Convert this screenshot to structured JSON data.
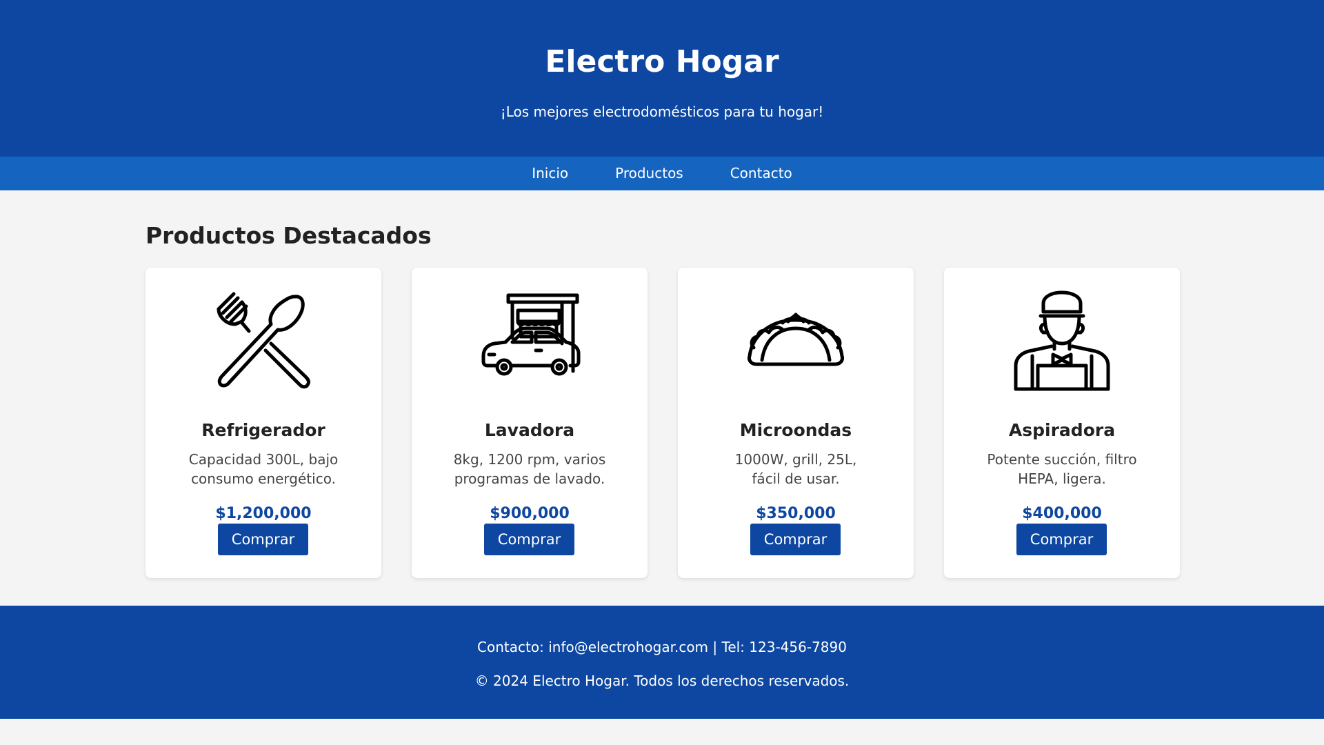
{
  "header": {
    "title": "Electro Hogar",
    "tagline": "¡Los mejores electrodomésticos para tu hogar!"
  },
  "nav": {
    "items": [
      {
        "label": "Inicio"
      },
      {
        "label": "Productos"
      },
      {
        "label": "Contacto"
      }
    ]
  },
  "main": {
    "section_title": "Productos Destacados",
    "products": [
      {
        "name": "Refrigerador",
        "description": "Capacidad 300L, bajo consumo energético.",
        "price": "$1,200,000",
        "button_label": "Comprar",
        "icon": "fork-spoon-icon"
      },
      {
        "name": "Lavadora",
        "description": "8kg, 1200 rpm, varios programas de lavado.",
        "price": "$900,000",
        "button_label": "Comprar",
        "icon": "drive-thru-car-icon"
      },
      {
        "name": "Microondas",
        "description": "1000W, grill, 25L, fácil de usar.",
        "price": "$350,000",
        "button_label": "Comprar",
        "icon": "taco-icon"
      },
      {
        "name": "Aspiradora",
        "description": "Potente succión, filtro HEPA, ligera.",
        "price": "$400,000",
        "button_label": "Comprar",
        "icon": "chef-person-icon"
      }
    ]
  },
  "footer": {
    "contact_prefix": "Contacto: ",
    "email": "info@electrohogar.com",
    "phone_text": " | Tel: 123-456-7890",
    "copyright": "© 2024 Electro Hogar. Todos los derechos reservados."
  },
  "colors": {
    "header_bg": "#0d47a1",
    "nav_bg": "#1565c0",
    "price_color": "#0d47a1",
    "page_bg": "#f4f4f4"
  }
}
